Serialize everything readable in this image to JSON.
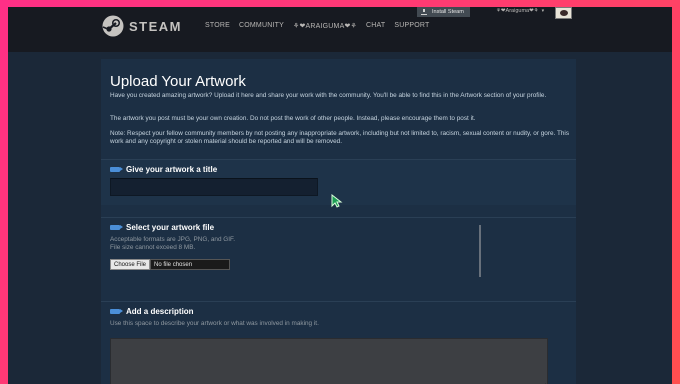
{
  "header": {
    "logo_text": "STEAM",
    "nav": [
      "STORE",
      "COMMUNITY",
      "⚘❤ARAIGUMA❤⚘",
      "CHAT",
      "SUPPORT"
    ],
    "install_label": "Install Steam",
    "account_name": "⚘❤Araiguma❤⚘",
    "account_chevron": "▾"
  },
  "main": {
    "title": "Upload Your Artwork",
    "intro": "Have you created amazing artwork? Upload it here and share your work with the community. You'll be able to find this in the Artwork section of your profile.",
    "rule": "The artwork you post must be your own creation. Do not post the work of other people. Instead, please encourage them to post it.",
    "note": "Note: Respect your fellow community members by not posting any inappropriate artwork, including but not limited to, racism, sexual content or nudity, or gore. This work and any copyright or stolen material should be reported and will be removed.",
    "title_section": {
      "heading": "Give your artwork a title",
      "value": ""
    },
    "file_section": {
      "heading": "Select your artwork file",
      "formats": "Acceptable formats are JPG, PNG, and GIF.",
      "size_limit": "File size cannot exceed 8 MB.",
      "choose_label": "Choose File",
      "no_file_label": "No file chosen"
    },
    "description_section": {
      "heading": "Add a description",
      "hint": "Use this space to describe your artwork or what was involved in making it.",
      "value": ""
    }
  },
  "colors": {
    "frame_gradient": [
      "#ff2f86",
      "#ff4f4f"
    ],
    "header_bg": "#171a21",
    "page_bg": "#1b2838",
    "section_tag": "#4b8fd8",
    "cursor_fill": "#1e9e55"
  },
  "icons": [
    "steam-logo-icon",
    "download-icon",
    "chevron-down-icon",
    "section-tag-icon",
    "mouse-cursor-icon"
  ]
}
